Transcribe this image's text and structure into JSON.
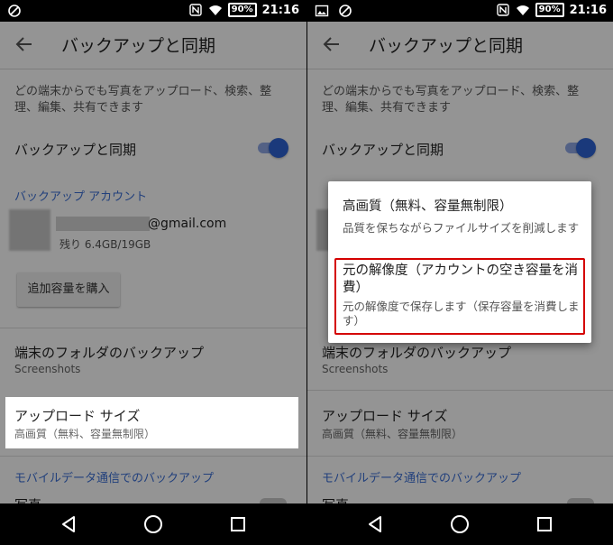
{
  "status_bar": {
    "battery": "90%",
    "time": "21:16"
  },
  "appbar": {
    "title": "バックアップと同期"
  },
  "settings": {
    "description": "どの端末からでも写真をアップロード、検索、整理、編集、共有できます",
    "backup_sync_label": "バックアップと同期",
    "account_section": "バックアップ アカウント",
    "email_suffix": "@gmail.com",
    "storage": "残り 6.4GB/19GB",
    "buy_storage_button": "追加容量を購入",
    "device_folders_label": "端末のフォルダのバックアップ",
    "device_folders_value": "Screenshots",
    "upload_size_label": "アップロード サイズ",
    "upload_size_value": "高画質（無料、容量無制限）",
    "mobile_data_section": "モバイルデータ通信でのバックアップ",
    "photos_label": "写真"
  },
  "dialog": {
    "options": [
      {
        "title": "高画質（無料、容量無制限）",
        "subtitle": "品質を保ちながらファイルサイズを削減します"
      },
      {
        "title": "元の解像度（アカウントの空き容量を消費）",
        "subtitle": "元の解像度で保存します（保存容量を消費します）"
      }
    ]
  },
  "colors": {
    "accent": "#3b6fd6",
    "toggle_on": "#2d63d4",
    "highlight_border": "#d40000"
  },
  "icons": {
    "status_left": [
      "image-icon",
      "rotation-icon"
    ],
    "status_right": [
      "nfc-icon",
      "wifi-icon",
      "battery-icon"
    ],
    "nav": [
      "back-triangle-icon",
      "home-circle-icon",
      "recents-square-icon"
    ]
  }
}
